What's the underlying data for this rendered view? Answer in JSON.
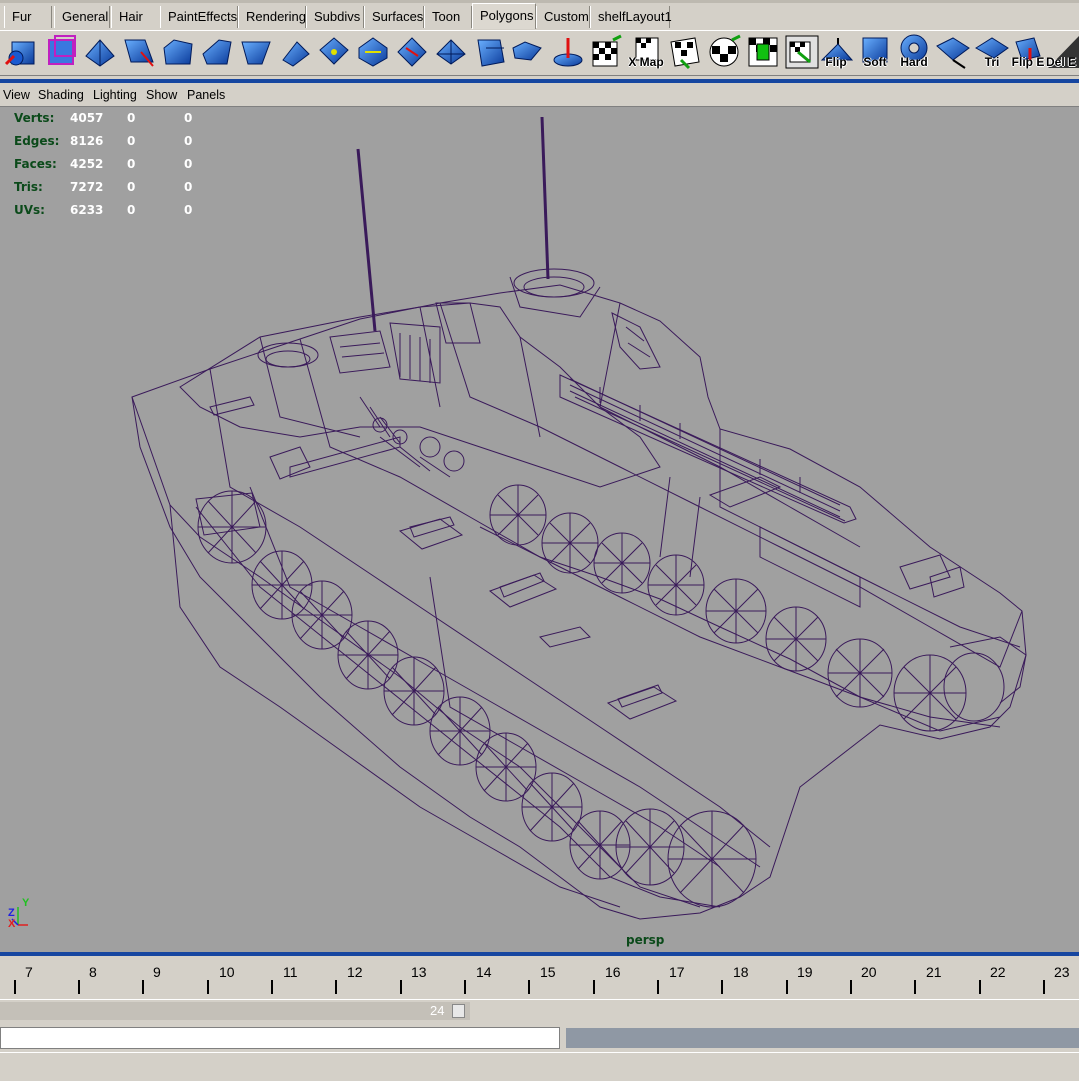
{
  "shelf_tabs": [
    "Fur",
    "General",
    "Hair",
    "PaintEffects",
    "Rendering",
    "Subdivs",
    "Surfaces",
    "Toon",
    "Polygons",
    "Custom",
    "shelfLayout1"
  ],
  "active_tab": "Polygons",
  "shelf_icon_labels": {
    "x_map": "X Map",
    "flip": "Flip",
    "soft": "Soft",
    "hard": "Hard",
    "tri": "Tri",
    "flip_e": "Flip E",
    "del_e": "Del E"
  },
  "panel_menu": [
    "View",
    "Shading",
    "Lighting",
    "Show",
    "Panels"
  ],
  "hud": {
    "rows": [
      {
        "label": "Verts:",
        "v1": "4057",
        "v2": "0",
        "v3": "0"
      },
      {
        "label": "Edges:",
        "v1": "8126",
        "v2": "0",
        "v3": "0"
      },
      {
        "label": "Faces:",
        "v1": "4252",
        "v2": "0",
        "v3": "0"
      },
      {
        "label": "Tris:",
        "v1": "7272",
        "v2": "0",
        "v3": "0"
      },
      {
        "label": "UVs:",
        "v1": "6233",
        "v2": "0",
        "v3": "0"
      }
    ]
  },
  "camera_label": "persp",
  "axis_labels": {
    "y": "Y",
    "z": "Z",
    "x": "X"
  },
  "timeline": {
    "ticks": [
      "7",
      "8",
      "9",
      "10",
      "11",
      "12",
      "13",
      "14",
      "15",
      "16",
      "17",
      "18",
      "19",
      "20",
      "21",
      "22",
      "23"
    ]
  },
  "range_end": "24",
  "colors": {
    "viewport_bg": "#a0a0a0",
    "wireframe": "#3a1a5a",
    "ui_bg": "#d4d0c8",
    "accent_blue": "#1646a0",
    "hud_label": "#0b4a1a"
  }
}
